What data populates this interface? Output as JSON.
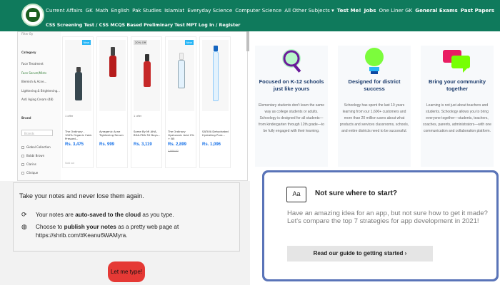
{
  "topbar": {
    "nav_primary": [
      "Current Affairs",
      "GK",
      "Math",
      "English",
      "Pak Studies",
      "Islamiat",
      "Everyday Science",
      "Computer Science",
      "All Other Subjects ▾",
      "Test Me!",
      "Jobs",
      "One Liner GK",
      "General Exams",
      "Past Papers"
    ],
    "nav_secondary": [
      "CSS Screening Test / CSS MCQS Based Preliminary Test",
      "MPT",
      "Log In / Register"
    ],
    "colors": {
      "nav_bg": "#0f7a5c"
    }
  },
  "shop": {
    "sidebar": {
      "filter_label": "Filter By",
      "category_header": "Category",
      "category_items": [
        "Face Treatment",
        "Face Serum/Mists",
        "Blemish & Acne...",
        "Lightening & Brightening...",
        "Anti Aging Cream (48)"
      ],
      "brand_header": "Brand",
      "brand_search_placeholder": "Brands",
      "brand_items": [
        "Global Collection",
        "Bobbi Brown",
        "Clarins",
        "Clinique"
      ]
    },
    "products": [
      {
        "badge": "New",
        "offer": "1 offer",
        "name": "The Ordinary - 100% Organic Cold-Pressed...",
        "price": "Rs. 3,475",
        "oldprice": "",
        "bottom": "Sold out"
      },
      {
        "badge": "",
        "offer": "",
        "name": "Avragenic Acne Tightening Serum",
        "price": "Rs. 999",
        "oldprice": "",
        "bottom": ""
      },
      {
        "badge": "20% Off",
        "offer": "1 offer",
        "name": "Some By Mi AHA-BHA-PHA 30 Days...",
        "price": "Rs. 3,119",
        "oldprice": "",
        "bottom": ""
      },
      {
        "badge": "New",
        "offer": "",
        "name": "The Ordinary Hyaluronic Acid 2% + B5",
        "price": "Rs. 2,899",
        "oldprice": "2,999.00",
        "bottom": ""
      },
      {
        "badge": "",
        "offer": "",
        "name": "SATIVA Dehydrated Hydrating Pure...",
        "price": "Rs. 1,096",
        "oldprice": "",
        "bottom": ""
      }
    ]
  },
  "note": {
    "headline": "Take your notes and never lose them again.",
    "autosave_text_pre": "Your notes are ",
    "autosave_bold": "auto-saved to the cloud",
    "autosave_text_post": " as you type.",
    "publish_pre": "Choose to ",
    "publish_bold": "publish your notes",
    "publish_post": " as a pretty web page at",
    "publish_url": "https://shrib.com/#Keanu6WAMyra.",
    "cta_label": "Let me type!",
    "colors": {
      "cta_bg": "#e53935"
    }
  },
  "features": [
    {
      "title": "Focused on K-12 schools just like yours",
      "desc": "Elementary students don't learn the same way as college students or adults. Schoology is designed for all students—from kindergarten through 12th grade—to be fully engaged with their learning.",
      "icon": "magnifier-icon"
    },
    {
      "title": "Designed for district success",
      "desc": "Schoology has spent the last 10 years learning from our 1,600+ customers and more than 20 million users about what products and services classrooms, schools, and entire districts need to be successful.",
      "icon": "lightbulb-icon"
    },
    {
      "title": "Bring your community together",
      "desc": "Learning is not just about teachers and students. Schoology allows you to bring everyone together—students, teachers, coaches, parents, administrators—with one communication and collaboration platform.",
      "icon": "chat-bubbles-icon"
    }
  ],
  "card": {
    "icon_text": "Aa",
    "title": "Not sure where to start?",
    "body": "Have an amazing idea for an app, but not sure how to get it made? Let's compare the top 7 strategies for app development in 2021!",
    "cta": "Read our guide to getting started ›",
    "colors": {
      "border": "#5a74b8"
    }
  }
}
